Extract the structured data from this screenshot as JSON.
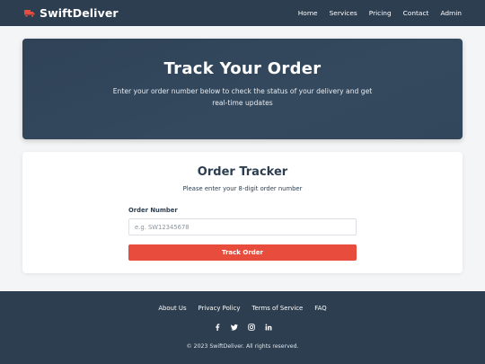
{
  "brand": {
    "name": "SwiftDeliver",
    "icon": "truck-icon",
    "icon_color": "#e74c3c"
  },
  "nav": {
    "items": [
      {
        "label": "Home"
      },
      {
        "label": "Services"
      },
      {
        "label": "Pricing"
      },
      {
        "label": "Contact"
      },
      {
        "label": "Admin"
      }
    ]
  },
  "hero": {
    "title": "Track Your Order",
    "subtitle": "Enter your order number below to check the status of your delivery and get real-time updates"
  },
  "tracker": {
    "title": "Order Tracker",
    "subtitle": "Please enter your 8-digit order number",
    "field_label": "Order Number",
    "input_value": "",
    "input_placeholder": "e.g. SW12345678",
    "button_label": "Track Order"
  },
  "footer": {
    "links": [
      {
        "label": "About Us"
      },
      {
        "label": "Privacy Policy"
      },
      {
        "label": "Terms of Service"
      },
      {
        "label": "FAQ"
      }
    ],
    "social": [
      "facebook-icon",
      "twitter-icon",
      "instagram-icon",
      "linkedin-icon"
    ],
    "copyright": "© 2023 SwiftDeliver. All rights reserved."
  },
  "colors": {
    "navy": "#2c3e50",
    "accent": "#e74c3c",
    "page_bg": "#f4f5f6",
    "white": "#ffffff"
  }
}
